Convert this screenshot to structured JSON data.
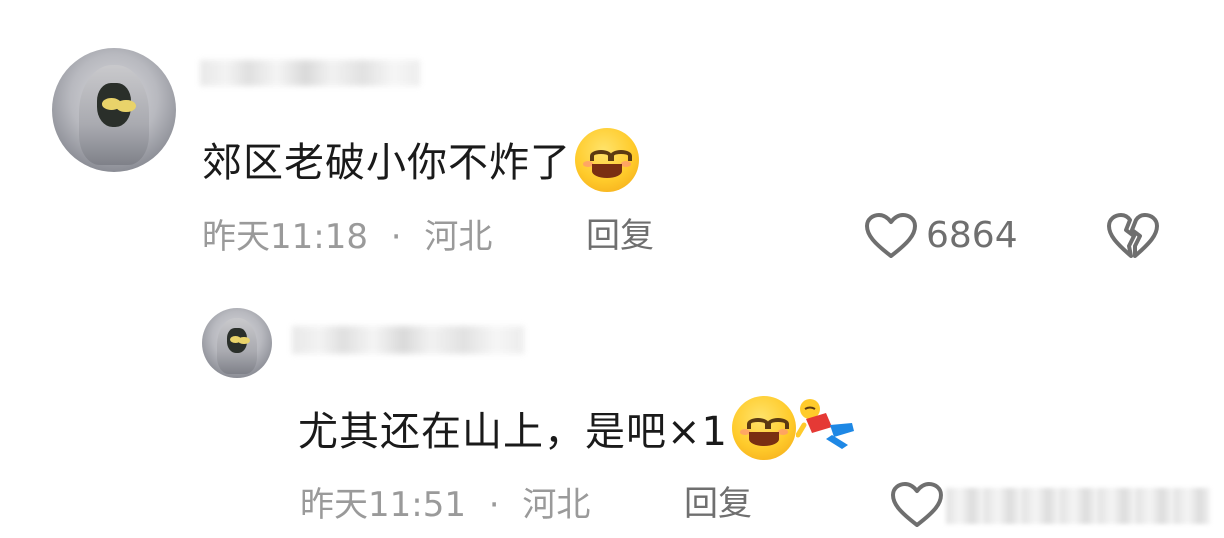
{
  "comments": [
    {
      "text": "郊区老破小你不炸了",
      "emojis": [
        "smiling-face-icon"
      ],
      "time": "昨天11:18",
      "separator": "·",
      "location": "河北",
      "reply_label": "回复",
      "likes": "6864"
    },
    {
      "text": "尤其还在山上，是吧×1",
      "emojis": [
        "smiling-face-icon",
        "fallen-person-icon"
      ],
      "time": "昨天11:51",
      "separator": "·",
      "location": "河北",
      "reply_label": "回复"
    }
  ],
  "colors": {
    "meta_gray": "#9a9a9a",
    "action_gray": "#6f6f6f",
    "text": "#1a1a1a",
    "background": "#ffffff"
  }
}
